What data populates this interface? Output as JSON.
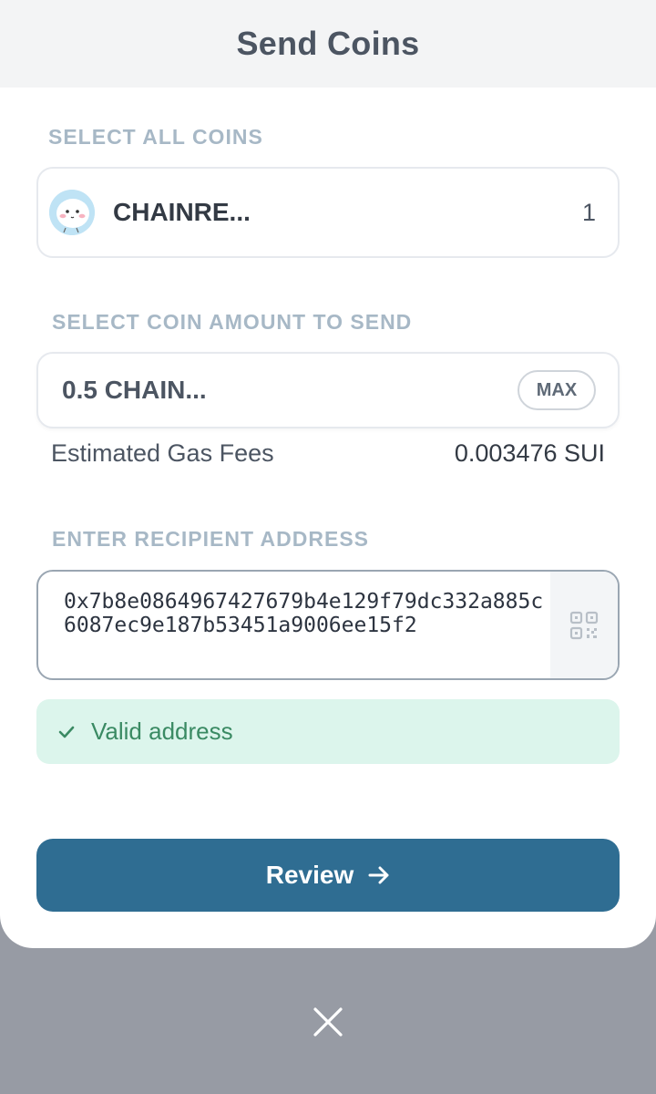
{
  "header": {
    "title": "Send Coins"
  },
  "coin_select": {
    "label": "SELECT ALL COINS",
    "coin_name": "CHAINRE...",
    "coin_count": "1",
    "avatar_icon": "cartoon-avatar-icon"
  },
  "amount": {
    "label": "SELECT COIN AMOUNT TO SEND",
    "value": "0.5 CHAIN...",
    "max_label": "MAX"
  },
  "gas": {
    "label": "Estimated Gas Fees",
    "value": "0.003476 SUI"
  },
  "recipient": {
    "label": "ENTER RECIPIENT ADDRESS",
    "address": "0x7b8e0864967427679b4e129f79dc332a885c6087ec9e187b53451a9006ee15f2",
    "qr_icon": "qr-code-icon"
  },
  "validation": {
    "message": "Valid address",
    "icon": "check-icon",
    "color": "#3a8a63"
  },
  "review": {
    "label": "Review",
    "icon": "arrow-right-icon",
    "color": "#2f6d92"
  },
  "close": {
    "icon": "close-icon"
  }
}
